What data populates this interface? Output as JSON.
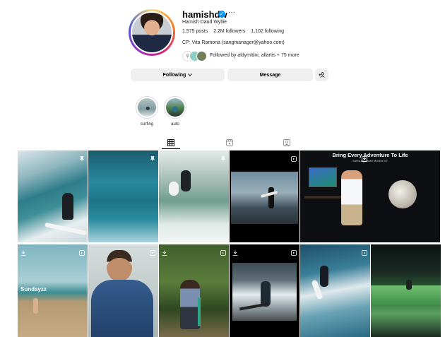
{
  "profile": {
    "username": "hamishdw",
    "full_name": "Hamish Daud Wyllie",
    "stats": {
      "posts": "1,575 posts",
      "followers": "2.2M followers",
      "following": "1,102 following"
    },
    "bio": "CP: Vita Ramona (sangmanager@yahoo.com)",
    "followed_by": "Followed by aldymldni, allartis + 75 more",
    "more_glyph": "···"
  },
  "actions": {
    "following_label": "Following",
    "message_label": "Message",
    "suggest_glyph": "+☹"
  },
  "highlights": [
    {
      "label": "surfing"
    },
    {
      "label": "auto"
    }
  ],
  "posts": {
    "promo_title": "Bring Every Adventure To Life",
    "promo_sub": "Samsung Smart Monitor M7",
    "caption_sunday": "Sundayzz"
  },
  "colors": {
    "accent": "#0095f6",
    "button_bg": "#efefef",
    "border": "#dbdbdb"
  }
}
